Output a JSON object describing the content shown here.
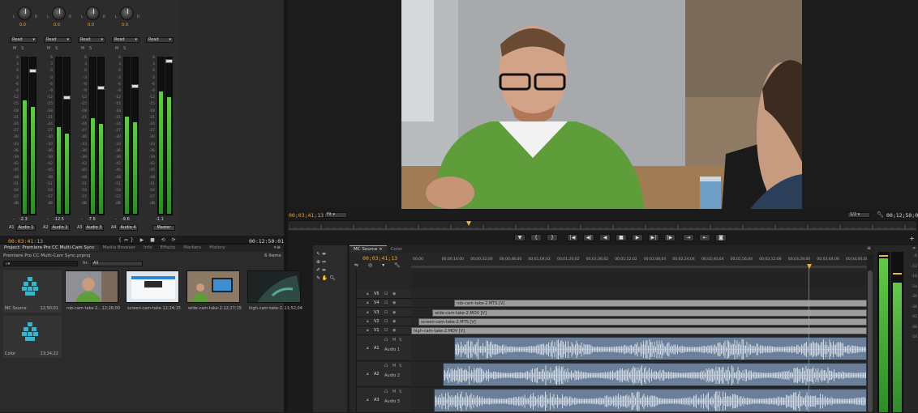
{
  "mixer": {
    "channels": [
      {
        "name": "Audio 1",
        "id": "A1",
        "mode": "Read",
        "pan": "0.0",
        "level": "-2.3",
        "level_frac": 0.72
      },
      {
        "name": "Audio 2",
        "id": "A2",
        "mode": "Read",
        "pan": "0.0",
        "level": "-12.5",
        "level_frac": 0.55
      },
      {
        "name": "Audio 3",
        "id": "A3",
        "mode": "Read",
        "pan": "0.0",
        "level": "-7.6",
        "level_frac": 0.61
      },
      {
        "name": "Audio 4",
        "id": "A4",
        "mode": "Read",
        "pan": "0.0",
        "level": "-9.6",
        "level_frac": 0.62
      }
    ],
    "master": {
      "name": "Master",
      "mode": "Read",
      "level": "-1.1",
      "level_frac": 0.78
    },
    "scale": [
      "6",
      "3",
      "0",
      "-3",
      "-6",
      "-9",
      "-12",
      "-15",
      "-18",
      "-21",
      "-24",
      "-27",
      "-30",
      "-33",
      "-36",
      "-39",
      "-42",
      "-45",
      "-48",
      "-51",
      "-54",
      "-57",
      "dB"
    ],
    "timecode_left": "00;03;41;13",
    "timecode_right": "00;12;50;01",
    "mute": "M",
    "solo": "S"
  },
  "program": {
    "timecode": "00;03;41;13",
    "fit": "Fit",
    "scale": "1/2",
    "duration": "00;12;50;01",
    "buttons": [
      "▼",
      "{",
      "}",
      "|◀",
      "◀|",
      "◀",
      "■",
      "▶",
      "▶|",
      "|▶"
    ]
  },
  "project": {
    "tabs": [
      "Project: Premiere Pro CC Multi-Cam Sync",
      "Media Browser",
      "Info",
      "Effects",
      "Markers",
      "History"
    ],
    "file": "Premiere Pro CC Multi-Cam Sync.prproj",
    "item_count": "6 Items",
    "search_placeholder": "",
    "in_label": "In:",
    "in_value": "All",
    "items": [
      {
        "name": "MC Source",
        "duration": "12;50;01",
        "kind": "sequence"
      },
      {
        "name": "rob-cam-take-2...",
        "duration": "12;26;00",
        "kind": "face"
      },
      {
        "name": "screen-cam-take...",
        "duration": "12;24;15",
        "kind": "screen"
      },
      {
        "name": "wide-cam-take-2...",
        "duration": "12;27;15",
        "kind": "wide"
      },
      {
        "name": "high-cam-take-2...",
        "duration": "11;52;04",
        "kind": "dark"
      },
      {
        "name": "Color",
        "duration": "13;24;22",
        "kind": "sequence"
      }
    ]
  },
  "timeline": {
    "tabs": [
      "MC Source",
      "Color"
    ],
    "timecode": "00;03;41;13",
    "ruler": [
      "00;00",
      "00;00;16;00",
      "00;00;32;00",
      "00;00;48;00",
      "00;01;04;02",
      "00;01;20;02",
      "00;01;36;02",
      "00;01;52;02",
      "00;02;08;04",
      "00;02;24;04",
      "00;02;40;04",
      "00;02;56;04",
      "00;03;12;06",
      "00;03;28;06",
      "00;03;44;06",
      "00;04;00;08"
    ],
    "video_tracks": [
      {
        "id": "V5",
        "clip": ""
      },
      {
        "id": "V4",
        "clip": "rob-cam-take-2.MTS [V]"
      },
      {
        "id": "V3",
        "clip": "wide-cam-take-2.MOV [V]"
      },
      {
        "id": "V2",
        "clip": "screen-cam-take-2.MTS [V]"
      },
      {
        "id": "V1",
        "clip": "high-cam-take-2.MOV [V]"
      }
    ],
    "audio_tracks": [
      {
        "id": "A1",
        "name": "Audio 1"
      },
      {
        "id": "A2",
        "name": "Audio 2"
      },
      {
        "id": "A3",
        "name": "Audio 3"
      }
    ],
    "meter_scale": [
      "-6",
      "-12",
      "-18",
      "-24",
      "-30",
      "-36",
      "-42",
      "-48",
      "-54"
    ]
  }
}
